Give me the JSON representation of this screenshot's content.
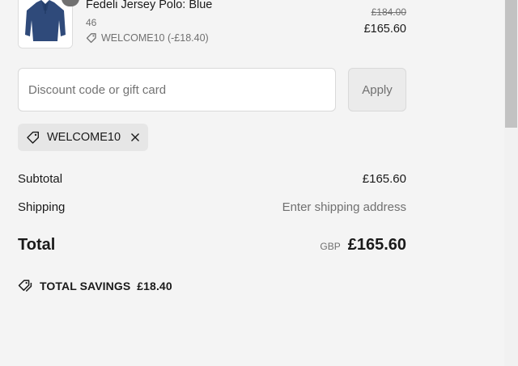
{
  "product": {
    "name": "Fedeli Jersey Polo: Blue",
    "variant": "46",
    "discount_note": "WELCOME10 (-£18.40)",
    "compare_price": "£184.00",
    "final_price": "£165.60",
    "quantity": ""
  },
  "discount": {
    "placeholder": "Discount code or gift card",
    "value": "",
    "apply_label": "Apply",
    "applied_code": "WELCOME10"
  },
  "summary": {
    "subtotal_label": "Subtotal",
    "subtotal_value": "£165.60",
    "shipping_label": "Shipping",
    "shipping_value": "Enter shipping address",
    "total_label": "Total",
    "currency": "GBP",
    "total_value": "£165.60",
    "savings_label": "TOTAL SAVINGS",
    "savings_value": "£18.40"
  },
  "colors": {
    "text": "#1a1a1a",
    "muted": "#707070",
    "background": "#f4f4f4",
    "product": "#2f4a7a"
  }
}
